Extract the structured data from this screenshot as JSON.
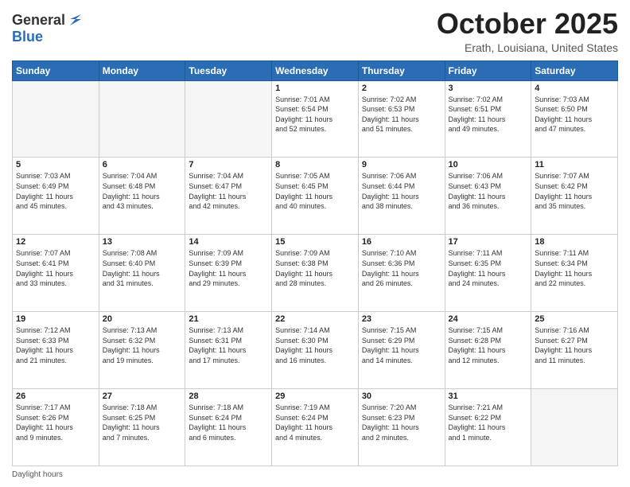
{
  "logo": {
    "general": "General",
    "blue": "Blue"
  },
  "header": {
    "month": "October 2025",
    "location": "Erath, Louisiana, United States"
  },
  "weekdays": [
    "Sunday",
    "Monday",
    "Tuesday",
    "Wednesday",
    "Thursday",
    "Friday",
    "Saturday"
  ],
  "weeks": [
    [
      {
        "day": "",
        "info": ""
      },
      {
        "day": "",
        "info": ""
      },
      {
        "day": "",
        "info": ""
      },
      {
        "day": "1",
        "info": "Sunrise: 7:01 AM\nSunset: 6:54 PM\nDaylight: 11 hours\nand 52 minutes."
      },
      {
        "day": "2",
        "info": "Sunrise: 7:02 AM\nSunset: 6:53 PM\nDaylight: 11 hours\nand 51 minutes."
      },
      {
        "day": "3",
        "info": "Sunrise: 7:02 AM\nSunset: 6:51 PM\nDaylight: 11 hours\nand 49 minutes."
      },
      {
        "day": "4",
        "info": "Sunrise: 7:03 AM\nSunset: 6:50 PM\nDaylight: 11 hours\nand 47 minutes."
      }
    ],
    [
      {
        "day": "5",
        "info": "Sunrise: 7:03 AM\nSunset: 6:49 PM\nDaylight: 11 hours\nand 45 minutes."
      },
      {
        "day": "6",
        "info": "Sunrise: 7:04 AM\nSunset: 6:48 PM\nDaylight: 11 hours\nand 43 minutes."
      },
      {
        "day": "7",
        "info": "Sunrise: 7:04 AM\nSunset: 6:47 PM\nDaylight: 11 hours\nand 42 minutes."
      },
      {
        "day": "8",
        "info": "Sunrise: 7:05 AM\nSunset: 6:45 PM\nDaylight: 11 hours\nand 40 minutes."
      },
      {
        "day": "9",
        "info": "Sunrise: 7:06 AM\nSunset: 6:44 PM\nDaylight: 11 hours\nand 38 minutes."
      },
      {
        "day": "10",
        "info": "Sunrise: 7:06 AM\nSunset: 6:43 PM\nDaylight: 11 hours\nand 36 minutes."
      },
      {
        "day": "11",
        "info": "Sunrise: 7:07 AM\nSunset: 6:42 PM\nDaylight: 11 hours\nand 35 minutes."
      }
    ],
    [
      {
        "day": "12",
        "info": "Sunrise: 7:07 AM\nSunset: 6:41 PM\nDaylight: 11 hours\nand 33 minutes."
      },
      {
        "day": "13",
        "info": "Sunrise: 7:08 AM\nSunset: 6:40 PM\nDaylight: 11 hours\nand 31 minutes."
      },
      {
        "day": "14",
        "info": "Sunrise: 7:09 AM\nSunset: 6:39 PM\nDaylight: 11 hours\nand 29 minutes."
      },
      {
        "day": "15",
        "info": "Sunrise: 7:09 AM\nSunset: 6:38 PM\nDaylight: 11 hours\nand 28 minutes."
      },
      {
        "day": "16",
        "info": "Sunrise: 7:10 AM\nSunset: 6:36 PM\nDaylight: 11 hours\nand 26 minutes."
      },
      {
        "day": "17",
        "info": "Sunrise: 7:11 AM\nSunset: 6:35 PM\nDaylight: 11 hours\nand 24 minutes."
      },
      {
        "day": "18",
        "info": "Sunrise: 7:11 AM\nSunset: 6:34 PM\nDaylight: 11 hours\nand 22 minutes."
      }
    ],
    [
      {
        "day": "19",
        "info": "Sunrise: 7:12 AM\nSunset: 6:33 PM\nDaylight: 11 hours\nand 21 minutes."
      },
      {
        "day": "20",
        "info": "Sunrise: 7:13 AM\nSunset: 6:32 PM\nDaylight: 11 hours\nand 19 minutes."
      },
      {
        "day": "21",
        "info": "Sunrise: 7:13 AM\nSunset: 6:31 PM\nDaylight: 11 hours\nand 17 minutes."
      },
      {
        "day": "22",
        "info": "Sunrise: 7:14 AM\nSunset: 6:30 PM\nDaylight: 11 hours\nand 16 minutes."
      },
      {
        "day": "23",
        "info": "Sunrise: 7:15 AM\nSunset: 6:29 PM\nDaylight: 11 hours\nand 14 minutes."
      },
      {
        "day": "24",
        "info": "Sunrise: 7:15 AM\nSunset: 6:28 PM\nDaylight: 11 hours\nand 12 minutes."
      },
      {
        "day": "25",
        "info": "Sunrise: 7:16 AM\nSunset: 6:27 PM\nDaylight: 11 hours\nand 11 minutes."
      }
    ],
    [
      {
        "day": "26",
        "info": "Sunrise: 7:17 AM\nSunset: 6:26 PM\nDaylight: 11 hours\nand 9 minutes."
      },
      {
        "day": "27",
        "info": "Sunrise: 7:18 AM\nSunset: 6:25 PM\nDaylight: 11 hours\nand 7 minutes."
      },
      {
        "day": "28",
        "info": "Sunrise: 7:18 AM\nSunset: 6:24 PM\nDaylight: 11 hours\nand 6 minutes."
      },
      {
        "day": "29",
        "info": "Sunrise: 7:19 AM\nSunset: 6:24 PM\nDaylight: 11 hours\nand 4 minutes."
      },
      {
        "day": "30",
        "info": "Sunrise: 7:20 AM\nSunset: 6:23 PM\nDaylight: 11 hours\nand 2 minutes."
      },
      {
        "day": "31",
        "info": "Sunrise: 7:21 AM\nSunset: 6:22 PM\nDaylight: 11 hours\nand 1 minute."
      },
      {
        "day": "",
        "info": ""
      }
    ]
  ],
  "footer": {
    "note": "Daylight hours"
  }
}
